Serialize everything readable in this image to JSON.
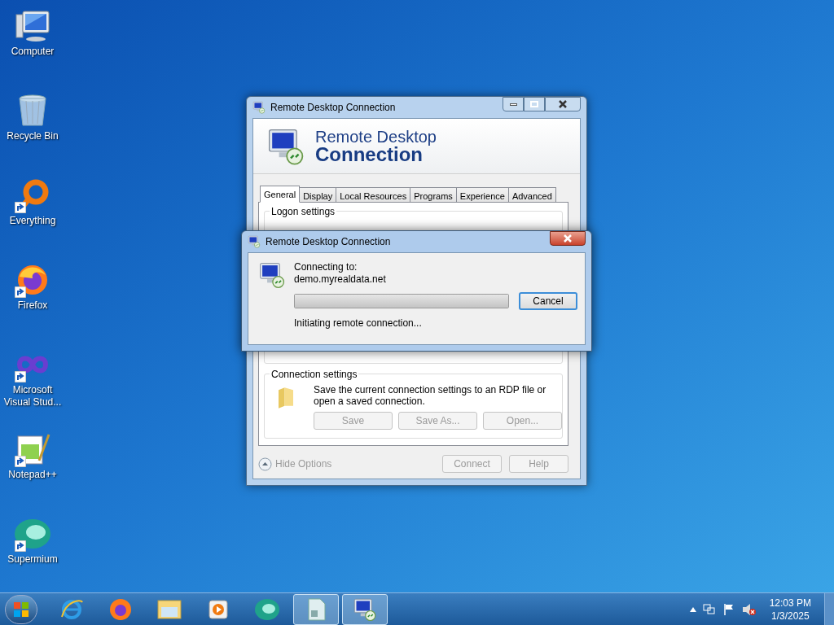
{
  "desktop_icons": [
    {
      "label": "Computer",
      "kind": "computer",
      "shortcut": false
    },
    {
      "label": "Recycle Bin",
      "kind": "recycle",
      "shortcut": false
    },
    {
      "label": "Everything",
      "kind": "everything",
      "shortcut": true
    },
    {
      "label": "Firefox",
      "kind": "firefox",
      "shortcut": true
    },
    {
      "label": "Microsoft Visual Stud...",
      "kind": "vs",
      "shortcut": true
    },
    {
      "label": "Notepad++",
      "kind": "notepad",
      "shortcut": true
    },
    {
      "label": "Supermium",
      "kind": "supermium",
      "shortcut": true
    }
  ],
  "main_window": {
    "title": "Remote Desktop Connection",
    "banner": {
      "line_1": "Remote Desktop",
      "line_2": "Connection"
    },
    "tabs": [
      {
        "label": "General",
        "selected": true
      },
      {
        "label": "Display",
        "selected": false
      },
      {
        "label": "Local Resources",
        "selected": false
      },
      {
        "label": "Programs",
        "selected": false
      },
      {
        "label": "Experience",
        "selected": false
      },
      {
        "label": "Advanced",
        "selected": false
      }
    ],
    "logon_settings": {
      "title": "Logon settings"
    },
    "connection_settings": {
      "title": "Connection settings",
      "description": "Save the current connection settings to an RDP file or open a saved connection.",
      "buttons": [
        {
          "label": "Save",
          "disabled": true
        },
        {
          "label": "Save As...",
          "disabled": true
        },
        {
          "label": "Open...",
          "disabled": true
        }
      ]
    },
    "hide_options": {
      "label": "Hide Options",
      "disabled": true
    },
    "buttons": [
      {
        "label": "Connect",
        "disabled": true
      },
      {
        "label": "Help",
        "disabled": true
      }
    ]
  },
  "dialog": {
    "title": "Remote Desktop Connection",
    "heading": "Connecting to:",
    "host": "demo.myrealdata.net",
    "progress": {
      "level": 1
    },
    "cancel": {
      "label": "Cancel",
      "focused": true
    },
    "status": "Initiating remote connection..."
  },
  "taskbar": {
    "items": [
      {
        "kind": "ie",
        "active": false
      },
      {
        "kind": "firefox",
        "active": false
      },
      {
        "kind": "explorer",
        "active": false
      },
      {
        "kind": "media",
        "active": false
      },
      {
        "kind": "supermium",
        "active": false
      },
      {
        "kind": "document",
        "active": true
      },
      {
        "kind": "rdp",
        "active": true
      }
    ],
    "time": "12:03 PM",
    "date": "1/3/2025"
  }
}
